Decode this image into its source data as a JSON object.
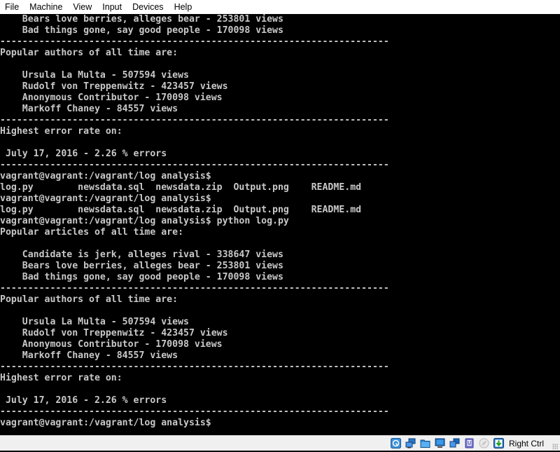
{
  "menubar": {
    "items": [
      "File",
      "Machine",
      "View",
      "Input",
      "Devices",
      "Help"
    ]
  },
  "terminal": {
    "lines": [
      "    Bears love berries, alleges bear - 253801 views",
      "    Bad things gone, say good people - 170098 views",
      "----------------------------------------------------------------------",
      "Popular authors of all time are:",
      "",
      "    Ursula La Multa - 507594 views",
      "    Rudolf von Treppenwitz - 423457 views",
      "    Anonymous Contributor - 170098 views",
      "    Markoff Chaney - 84557 views",
      "----------------------------------------------------------------------",
      "Highest error rate on:",
      "",
      " July 17, 2016 - 2.26 % errors",
      "----------------------------------------------------------------------",
      "vagrant@vagrant:/vagrant/log analysis$",
      "log.py        newsdata.sql  newsdata.zip  Output.png    README.md",
      "vagrant@vagrant:/vagrant/log analysis$",
      "log.py        newsdata.sql  newsdata.zip  Output.png    README.md",
      "vagrant@vagrant:/vagrant/log analysis$ python log.py",
      "Popular articles of all time are:",
      "",
      "    Candidate is jerk, alleges rival - 338647 views",
      "    Bears love berries, alleges bear - 253801 views",
      "    Bad things gone, say good people - 170098 views",
      "----------------------------------------------------------------------",
      "Popular authors of all time are:",
      "",
      "    Ursula La Multa - 507594 views",
      "    Rudolf von Treppenwitz - 423457 views",
      "    Anonymous Contributor - 170098 views",
      "    Markoff Chaney - 84557 views",
      "----------------------------------------------------------------------",
      "Highest error rate on:",
      "",
      " July 17, 2016 - 2.26 % errors",
      "----------------------------------------------------------------------",
      "vagrant@vagrant:/vagrant/log analysis$"
    ]
  },
  "statusbar": {
    "icons": [
      "hard-disk-icon",
      "network-icon",
      "shared-folders-icon",
      "display-icon",
      "video-capture-icon",
      "usb-icon",
      "mouse-integration-icon",
      "guest-additions-icon"
    ],
    "host_key_label": "Right Ctrl"
  }
}
